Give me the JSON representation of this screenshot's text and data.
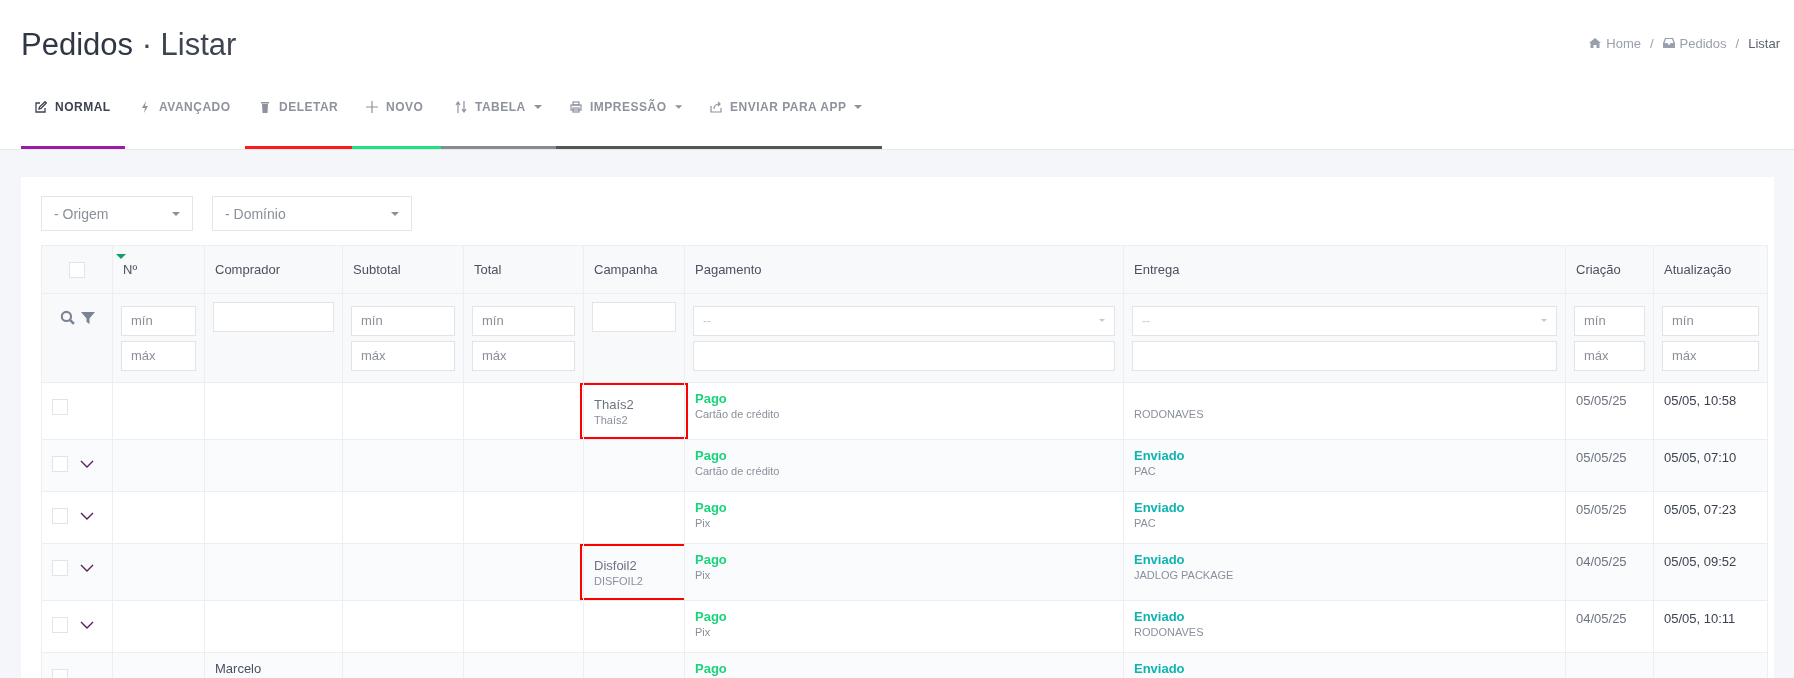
{
  "page": {
    "title": "Pedidos",
    "separator": "·",
    "subtitle": "Listar"
  },
  "breadcrumb": [
    {
      "label": "Home"
    },
    {
      "separator": "/",
      "label": "Pedidos"
    },
    {
      "separator": "/",
      "label": "Listar"
    }
  ],
  "tabs": [
    {
      "label": "NORMAL",
      "selected": true,
      "color": "#9c1aa8"
    },
    {
      "label": "AVANÇADO",
      "selected": false
    },
    {
      "label": "DELETAR",
      "selected": false,
      "color": "#ff1a1a"
    },
    {
      "label": "NOVO",
      "selected": false,
      "color": "#1ee27f"
    },
    {
      "label": "TABELA",
      "selected": false,
      "dropdown": true,
      "color": "#868b96"
    },
    {
      "label": "IMPRESSÃO",
      "selected": false,
      "dropdown": true,
      "color": "#555555"
    },
    {
      "label": "ENVIAR PARA APP",
      "selected": false,
      "dropdown": true,
      "color": "#555555"
    }
  ],
  "filters": [
    {
      "placeholder": "- Origem"
    },
    {
      "placeholder": "- Domínio"
    }
  ],
  "table": {
    "columns": [
      {
        "kind": "check",
        "checked": false
      },
      {
        "label": "Nº",
        "kind": "range",
        "sorted": true,
        "filters": [
          {
            "placeholder": "mín"
          },
          {
            "placeholder": "máx"
          }
        ]
      },
      {
        "label": "Comprador",
        "kind": "text"
      },
      {
        "label": "Subtotal",
        "kind": "range",
        "filters": [
          {
            "placeholder": "mín"
          },
          {
            "placeholder": "máx"
          }
        ]
      },
      {
        "label": "Total",
        "kind": "range",
        "filters": [
          {
            "placeholder": "mín"
          },
          {
            "placeholder": "máx"
          }
        ]
      },
      {
        "label": "Campanha",
        "kind": "text"
      },
      {
        "label": "Pagamento",
        "kind": "select",
        "filters": [
          {
            "placeholder": "--"
          }
        ]
      },
      {
        "label": "Entrega",
        "kind": "select",
        "filters": [
          {
            "placeholder": "--"
          }
        ]
      },
      {
        "label": "Criação",
        "kind": "range",
        "filters": [
          {
            "placeholder": "mín"
          },
          {
            "placeholder": "máx"
          }
        ]
      },
      {
        "label": "Atualização",
        "kind": "range",
        "filters": [
          {
            "placeholder": "mín"
          },
          {
            "placeholder": "máx"
          }
        ]
      }
    ],
    "rows": [
      {
        "checked": false,
        "expandable": false,
        "campaign": {
          "name": "Thaís2",
          "code": "Thaís2",
          "highlighted": true
        },
        "payment": {
          "status": "Pago",
          "method": "Cartão de crédito"
        },
        "delivery": {
          "carrier": "RODONAVES"
        },
        "created": "05/05/25",
        "updated": "05/05, 10:58"
      },
      {
        "checked": false,
        "expandable": true,
        "payment": {
          "status": "Pago",
          "method": "Cartão de crédito"
        },
        "delivery": {
          "status": "Enviado",
          "carrier": "PAC"
        },
        "created": "05/05/25",
        "updated": "05/05, 07:10"
      },
      {
        "checked": false,
        "expandable": true,
        "payment": {
          "status": "Pago",
          "method": "Pix"
        },
        "delivery": {
          "status": "Enviado",
          "carrier": "PAC"
        },
        "created": "05/05/25",
        "updated": "05/05, 07:23"
      },
      {
        "checked": false,
        "expandable": true,
        "campaign": {
          "name": "Disfoil2",
          "code": "DISFOIL2",
          "highlighted": true
        },
        "payment": {
          "status": "Pago",
          "method": "Pix"
        },
        "delivery": {
          "status": "Enviado",
          "carrier": "JADLOG PACKAGE"
        },
        "created": "04/05/25",
        "updated": "05/05, 09:52"
      },
      {
        "checked": false,
        "expandable": true,
        "payment": {
          "status": "Pago",
          "method": "Pix"
        },
        "delivery": {
          "status": "Enviado",
          "carrier": "RODONAVES"
        },
        "created": "04/05/25",
        "updated": "05/05, 10:11"
      },
      {
        "checked": false,
        "expandable": false,
        "buyer": "Marcelo",
        "payment": {
          "status": "Pago"
        },
        "delivery": {
          "status": "Enviado"
        }
      }
    ]
  }
}
